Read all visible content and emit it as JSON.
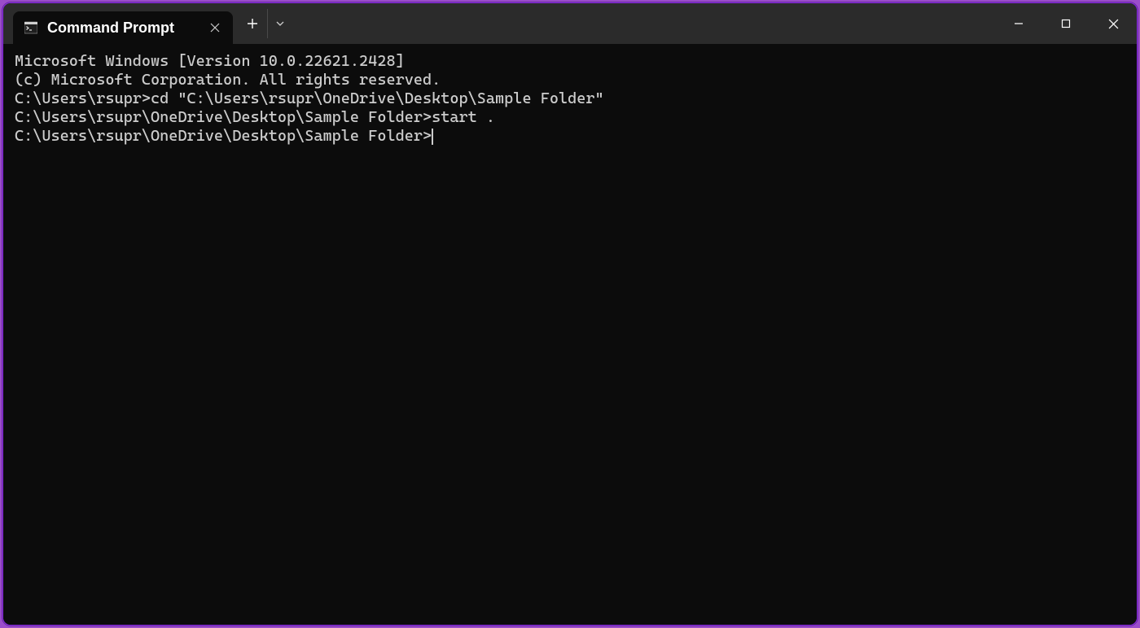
{
  "titlebar": {
    "tab": {
      "title": "Command Prompt"
    }
  },
  "terminal": {
    "lines": [
      "Microsoft Windows [Version 10.0.22621.2428]",
      "(c) Microsoft Corporation. All rights reserved.",
      "",
      "C:\\Users\\rsupr>cd \"C:\\Users\\rsupr\\OneDrive\\Desktop\\Sample Folder\"",
      "",
      "C:\\Users\\rsupr\\OneDrive\\Desktop\\Sample Folder>start .",
      "",
      "C:\\Users\\rsupr\\OneDrive\\Desktop\\Sample Folder>"
    ],
    "cursor_on_line": 7
  }
}
